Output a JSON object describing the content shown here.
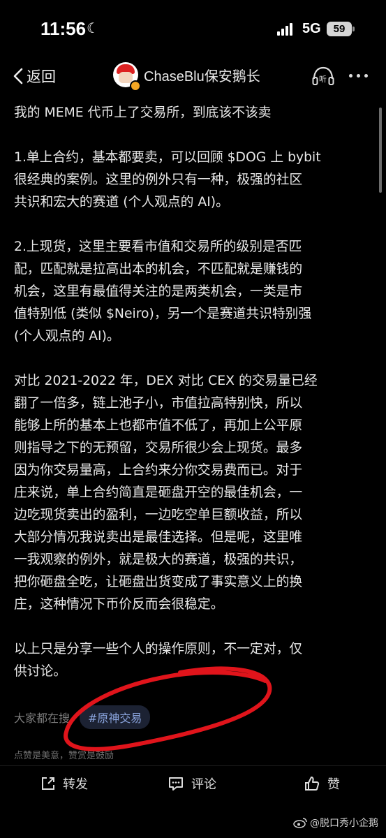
{
  "status": {
    "time": "11:56",
    "network": "5G",
    "battery": "59"
  },
  "nav": {
    "back_label": "返回",
    "author": "ChaseBlu保安鹅长"
  },
  "post": {
    "title": "我的 MEME 代币上了交易所，到底该不该卖",
    "p1": [
      "1.单上合约，基本都要卖，可以回顾 $DOG 上 bybit",
      "很经典的案例。这里的例外只有一种，极强的社区",
      "共识和宏大的赛道 (个人观点的 AI)。"
    ],
    "p2": [
      "2.上现货，这里主要看市值和交易所的级别是否匹",
      "配，匹配就是拉高出本的机会，不匹配就是赚钱的",
      "机会，这里有最值得关注的是两类机会，一类是市",
      "值特别低 (类似 $Neiro)，另一个是赛道共识特别强",
      "(个人观点的 AI)。"
    ],
    "p3": [
      "对比 2021-2022 年，DEX 对比 CEX 的交易量已经",
      "翻了一倍多，链上池子小，市值拉高特别快，所以",
      "能够上所的基本上也都市值不低了，再加上公平原",
      "则指导之下的无预留，交易所很少会上现货。最多",
      "因为你交易量高，上合约来分你交易费而已。对于",
      "庄来说，单上合约简直是砸盘开空的最佳机会，一",
      "边吃现货卖出的盈利，一边吃空单巨额收益，所以",
      "大部分情况我说卖出是最佳选择。但是呢，这里唯",
      "一我观察的例外，就是极大的赛道，极强的共识，",
      "把你砸盘全吃，让砸盘出货变成了事实意义上的换",
      "庄，这种情况下币价反而会很稳定。"
    ],
    "p4": [
      "以上只是分享一些个人的操作原则，不一定对，仅",
      "供讨论。"
    ]
  },
  "topic": {
    "label": "大家都在搜",
    "tag": "#原神交易"
  },
  "hint": "点赞是美意，赞赏是鼓励",
  "actions": {
    "repost": "转发",
    "comment": "评论",
    "like": "赞"
  },
  "watermark": "@脱口秀小企鹅",
  "colors": {
    "background": "#000000",
    "annotation": "#e0141b",
    "topic_chip": "#1c2233",
    "topic_text": "#8aa4dd"
  }
}
